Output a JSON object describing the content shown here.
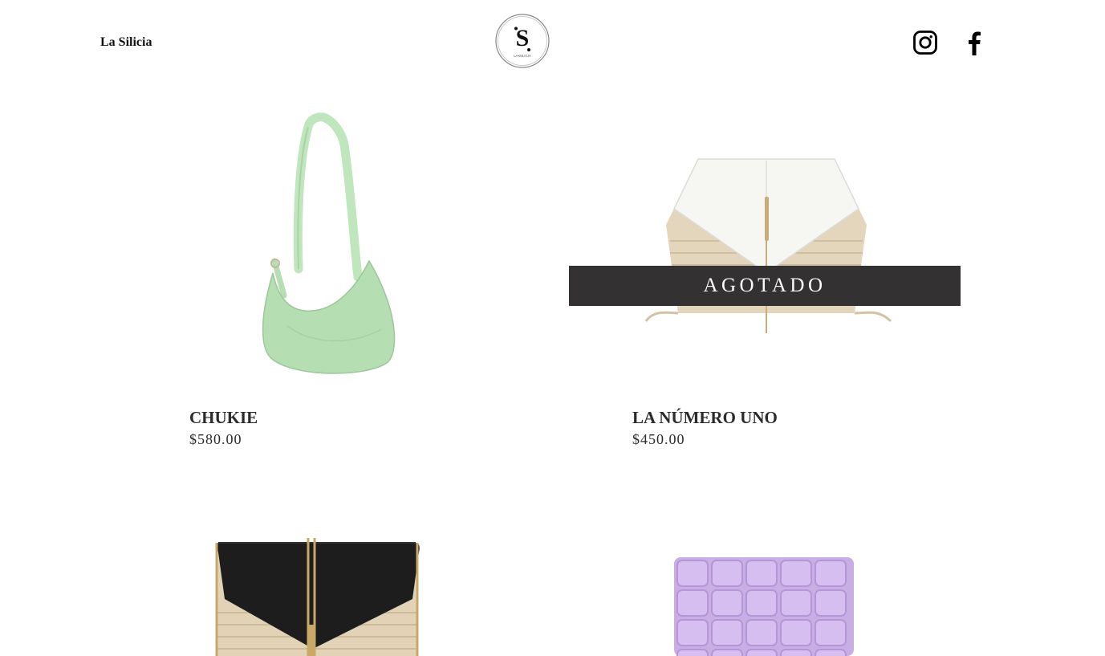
{
  "header": {
    "brand": "La Silicia",
    "logo": {
      "letter": "S",
      "caption": "LA•SILICIA"
    },
    "social": [
      {
        "icon": "instagram-icon"
      },
      {
        "icon": "facebook-icon"
      }
    ]
  },
  "products": [
    {
      "name": "CHUKIE",
      "price": "$580.00",
      "color": "#b5deb2"
    },
    {
      "name": "LA NÚMERO UNO",
      "price": "$450.00",
      "color": "#f4f4f2",
      "badge": "AGOTADO"
    },
    {
      "name": "",
      "price": "",
      "color": "#1d1d1d"
    },
    {
      "name": "",
      "price": "",
      "color": "#c9aee6"
    }
  ]
}
